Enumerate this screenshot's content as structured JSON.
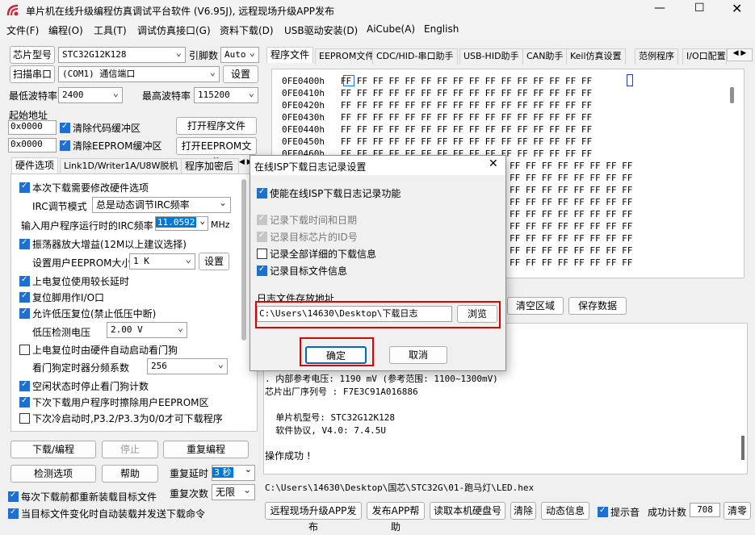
{
  "window": {
    "title": "单片机在线升级编程仿真调试平台软件 (V6.95J), 远程现场升级APP发布"
  },
  "menu": [
    "文件(F)",
    "编程(O)",
    "工具(T)",
    "调试仿真接口(G)",
    "资料下载(D)",
    "USB驱动安装(D)",
    "AiCube(A)",
    "English"
  ],
  "left": {
    "chip_label": "芯片型号",
    "chip_value": "STC32G12K128",
    "pins_label": "引脚数",
    "pins_value": "Auto",
    "scan_button": "扫描串口",
    "port_value": "(COM1) 通信端口",
    "settings_button": "设置",
    "min_baud_label": "最低波特率",
    "min_baud_value": "2400",
    "max_baud_label": "最高波特率",
    "max_baud_value": "115200",
    "start_addr_label": "起始地址",
    "addr1": "0x0000",
    "clear_code": "清除代码缓冲区",
    "open_program": "打开程序文件",
    "addr2": "0x0000",
    "clear_eeprom": "清除EEPROM缓冲区",
    "open_eeprom": "打开EEPROM文件",
    "tabs": [
      "硬件选项",
      "Link1D/Writer1A/U8W脱机",
      "程序加密后"
    ],
    "hw": {
      "modify_hw": "本次下载需要修改硬件选项",
      "irc_mode_label": "IRC调节模式",
      "irc_mode_value": "总是动态调节IRC频率",
      "irc_freq_label": "输入用户程序运行时的IRC频率",
      "irc_freq_value": "11.0592",
      "irc_unit": "MHz",
      "osc_gain": "振荡器放大增益(12M以上建议选择)",
      "eeprom_size_label": "设置用户EEPROM大小",
      "eeprom_size_value": "1   K",
      "eeprom_set": "设置",
      "long_delay": "上电复位使用较长延时",
      "reset_pin": "复位脚用作I/O口",
      "lvd_reset": "允许低压复位(禁止低压中断)",
      "lvd_label": "低压检测电压",
      "lvd_value": "2.00 V",
      "wdt_start": "上电复位时由硬件自动启动看门狗",
      "wdt_div_label": "看门狗定时器分频系数",
      "wdt_div_value": "256",
      "idle_wdt": "空闲状态时停止看门狗计数",
      "erase_eeprom": "下次下载用户程序时擦除用户EEPROM区",
      "p32_p33": "下次冷启动时,P3.2/P3.3为0/0才可下载程序"
    },
    "download_btn": "下载/编程",
    "stop_btn": "停止",
    "reprogram_btn": "重复编程",
    "detect_btn": "检测选项",
    "help_btn": "帮助",
    "repeat_delay_label": "重复延时",
    "repeat_delay_value": "3 秒",
    "repeat_count_label": "重复次数",
    "repeat_count_value": "无限",
    "reload_each": "每次下载前都重新装载目标文件",
    "auto_download": "当目标文件变化时自动装载并发送下载命令"
  },
  "right": {
    "tabs": [
      "程序文件",
      "EEPROM文件",
      "CDC/HID-串口助手",
      "USB-HID助手",
      "CAN助手",
      "Keil仿真设置",
      "范例程序",
      "I/O口配置"
    ],
    "hex_rows": [
      {
        "addr": "0FE0400h",
        "bytes": "FF FF FF FF FF FF FF FF FF FF FF FF FF FF FF FF"
      },
      {
        "addr": "0FE0410h",
        "bytes": "FF FF FF FF FF FF FF FF FF FF FF FF FF FF FF FF"
      },
      {
        "addr": "0FE0420h",
        "bytes": "FF FF FF FF FF FF FF FF FF FF FF FF FF FF FF FF"
      },
      {
        "addr": "0FE0430h",
        "bytes": "FF FF FF FF FF FF FF FF FF FF FF FF FF FF FF FF"
      },
      {
        "addr": "0FE0440h",
        "bytes": "FF FF FF FF FF FF FF FF FF FF FF FF FF FF FF FF"
      },
      {
        "addr": "0FE0450h",
        "bytes": "FF FF FF FF FF FF FF FF FF FF FF FF FF FF FF FF"
      },
      {
        "addr": "0FE0460h",
        "bytes": "FF FF FF FF FF FF FF FF FF FF FF FF FF FF FF FF"
      }
    ],
    "hex_right_rows": [
      "FF FF FF FF FF FF FF FF",
      "FF FF FF FF FF FF FF FF",
      "FF FF FF FF FF FF FF FF",
      "FF FF FF FF FF FF FF FF",
      "FF FF FF FF FF FF FF FF",
      "FF FF FF FF FF FF FF FF",
      "FF FF FF FF FF FF FF FF",
      "FF FF FF FF FF FF FF FF",
      "FF FF FF FF FF FF FF FF"
    ],
    "clear_area": "清空区域",
    "save_data": "保存数据",
    "log_lines": [
      ". 内部参考电压: 1190 mV (参考范围: 1100~1300mV)",
      "芯片出厂序列号 : F7E3C91A016886",
      "",
      "  单片机型号: STC32G12K128",
      "  软件协议, V4.0: 7.4.5U",
      "",
      "操作成功 !"
    ],
    "file_path": "C:\\Users\\14630\\Desktop\\国芯\\STC32G\\01-跑马灯\\LED.hex",
    "bottom_buttons": [
      "远程现场升级APP发布",
      "发布APP帮助",
      "读取本机硬盘号",
      "清除",
      "动态信息"
    ],
    "beep_label": "提示音",
    "success_label": "成功计数",
    "success_value": "708",
    "clear_count": "清零"
  },
  "dialog": {
    "title": "在线ISP下载日志记录设置",
    "enable": "使能在线ISP下载日志记录功能",
    "rec_time": "记录下载时间和日期",
    "rec_id": "记录目标芯片的ID号",
    "rec_all": "记录全部详细的下载信息",
    "rec_file": "记录目标文件信息",
    "path_label": "日志文件存放地址",
    "path_value": "C:\\Users\\14630\\Desktop\\下载日志",
    "browse": "浏览",
    "ok": "确定",
    "cancel": "取消"
  },
  "colors": {
    "accent": "#1f6fd1",
    "highlight": "#e00000"
  }
}
